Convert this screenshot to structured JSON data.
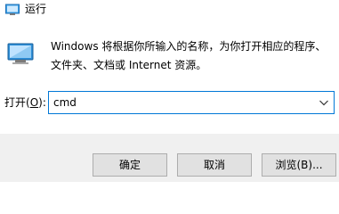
{
  "window": {
    "title": "运行",
    "title_icon": "run-app-icon"
  },
  "dialog": {
    "icon": "run-app-icon",
    "description_line1": "Windows 将根据你所输入的名称，为你打开相应的程序、",
    "description_line2": "文件夹、文档或 Internet 资源。",
    "open_label_prefix": "打开(",
    "open_label_accel": "O",
    "open_label_suffix": "):",
    "open_value": "cmd"
  },
  "buttons": {
    "ok_label": "确定",
    "cancel_label": "取消",
    "browse_label": "浏览(B)..."
  },
  "colors": {
    "accent": "#0078d7",
    "footer_bg": "#f0f0f0",
    "button_bg": "#e1e1e1",
    "button_border": "#adadad"
  }
}
